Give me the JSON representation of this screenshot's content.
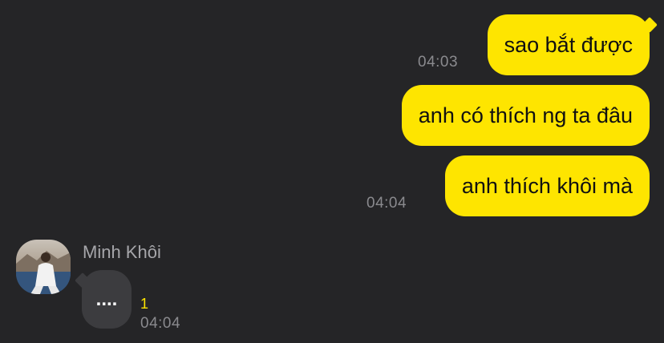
{
  "colors": {
    "background": "#252527",
    "outgoing_bubble": "#fee500",
    "incoming_bubble": "#3c3c3f",
    "timestamp": "#8a8a8e",
    "unread_count": "#fee500"
  },
  "messages_out": [
    {
      "text": "sao bắt được",
      "time": "04:03"
    },
    {
      "text": "anh có thích ng ta đâu",
      "time": ""
    },
    {
      "text": "anh thích khôi mà",
      "time": "04:04"
    }
  ],
  "incoming": {
    "sender_name": "Minh Khôi",
    "avatar_icon": "profile-photo",
    "message_text": "....",
    "unread_count": "1",
    "time": "04:04"
  }
}
